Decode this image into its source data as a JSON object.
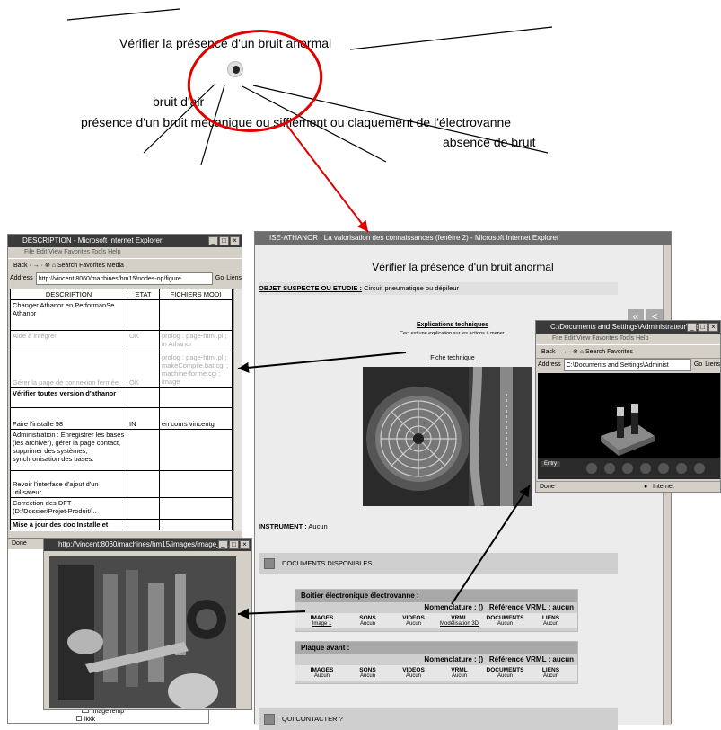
{
  "diagram": {
    "title": "Vérifier la présence d'un bruit anormal",
    "branch_air": "bruit d'air",
    "branch_mechanical": "présence d'un bruit mécanique ou sifflement ou claquement de l'électrovanne",
    "branch_none": "absence de bruit"
  },
  "main_window": {
    "title": "ISE-ATHANOR : La valorisation des connaissances (fenêtre 2) - Microsoft Internet Explorer",
    "page_title": "Vérifier la présence d'un bruit anormal",
    "object_label": "OBJET SUSPECTE OU ETUDIE :",
    "object_value": "Circuit pneumatique ou dépileur",
    "explications_title": "Explications techniques",
    "explications_text": "Ceci est une explication sur les actions à mener.",
    "fiche_link": "Fiche technique",
    "instrument_label": "INSTRUMENT :",
    "instrument_value": "Aucun",
    "documents_label": "DOCUMENTS DISPONIBLES",
    "contact_label": "QUI CONTACTER ?",
    "nav_back": "«",
    "nav_prev": "<"
  },
  "doc_tables": [
    {
      "title": "Boitier électronique électrovanne :",
      "nomenclature": "Nomenclature : ()",
      "vrml_ref": "Référence VRML : aucun",
      "cols": [
        {
          "head": "IMAGES",
          "val": "Image 1"
        },
        {
          "head": "SONS",
          "val": "Aucun"
        },
        {
          "head": "VIDEOS",
          "val": "Aucun"
        },
        {
          "head": "VRML",
          "val": "Modélisation 3D"
        },
        {
          "head": "DOCUMENTS",
          "val": "Aucun"
        },
        {
          "head": "LIENS",
          "val": "Aucun"
        }
      ]
    },
    {
      "title": "Plaque avant :",
      "nomenclature": "Nomenclature : ()",
      "vrml_ref": "Référence VRML : aucun",
      "cols": [
        {
          "head": "IMAGES",
          "val": "Aucun"
        },
        {
          "head": "SONS",
          "val": "Aucun"
        },
        {
          "head": "VIDEOS",
          "val": "Aucun"
        },
        {
          "head": "VRML",
          "val": "Aucun"
        },
        {
          "head": "DOCUMENTS",
          "val": "Aucun"
        },
        {
          "head": "LIENS",
          "val": "Aucun"
        }
      ]
    }
  ],
  "left_window": {
    "title": "DESCRIPTION - Microsoft Internet Explorer",
    "menu": "File   Edit   View   Favorites   Tools   Help",
    "toolbar": "Back · → · ⊗ ⌂   Search   Favorites   Media",
    "address_label": "Address",
    "address_value": "http://vincent:8060/machines/hm15/nodes-op/figure",
    "go": "Go",
    "links": "Liens",
    "headers": [
      "DESCRIPTION",
      "ETAT",
      "FICHIERS MODI"
    ],
    "rows": [
      [
        "Changer Athanor en PerformanSe Athanor",
        "",
        ""
      ],
      [
        "Aide à intégrer",
        "OK",
        "prolog : page-html.pl ; in Athanor"
      ],
      [
        "Gérer la page de connexion fermée",
        "OK",
        "prolog : page-html.pl ; makeCompile.bat.cgi ; machine-forme.cgi ; image"
      ],
      [
        "Vérifier toutes version d'athanor",
        "",
        ""
      ],
      [
        "Faire l'installe 98",
        "IN",
        "en cours vincentg"
      ],
      [
        "Administration : Enregistrer les bases (les archiver), gérer la page contact, supprimer des systèmes, synchronisation des bases.",
        "",
        ""
      ],
      [
        "Revoir l'interface d'ajout d'un utilisateur",
        "",
        ""
      ],
      [
        "Correction des DFT (D:/Dossier/Projet-Produit/...",
        "",
        ""
      ],
      [
        "Mise à jour des doc Installe et",
        "",
        ""
      ]
    ],
    "status_done": "Done"
  },
  "image_window": {
    "title": "http://vincent:8060/machines/hm15/images/image_1.j...",
    "tree_items": [
      "imageTemp",
      "lkkk"
    ]
  },
  "vrml_window": {
    "title": "C:\\Documents and Settings\\Administrateur\\Local ...",
    "menu": "File   Edit   View   Favorites   Tools   Help",
    "toolbar": "Back · → · ⊗ ⌂   Search   Favorites",
    "address_label": "Address",
    "address_value": "C:\\Documents and Settings\\Administ",
    "go": "Go",
    "links": "Liens",
    "viewer_mode": "Entry",
    "status_done": "Done",
    "status_zone": "Internet"
  }
}
